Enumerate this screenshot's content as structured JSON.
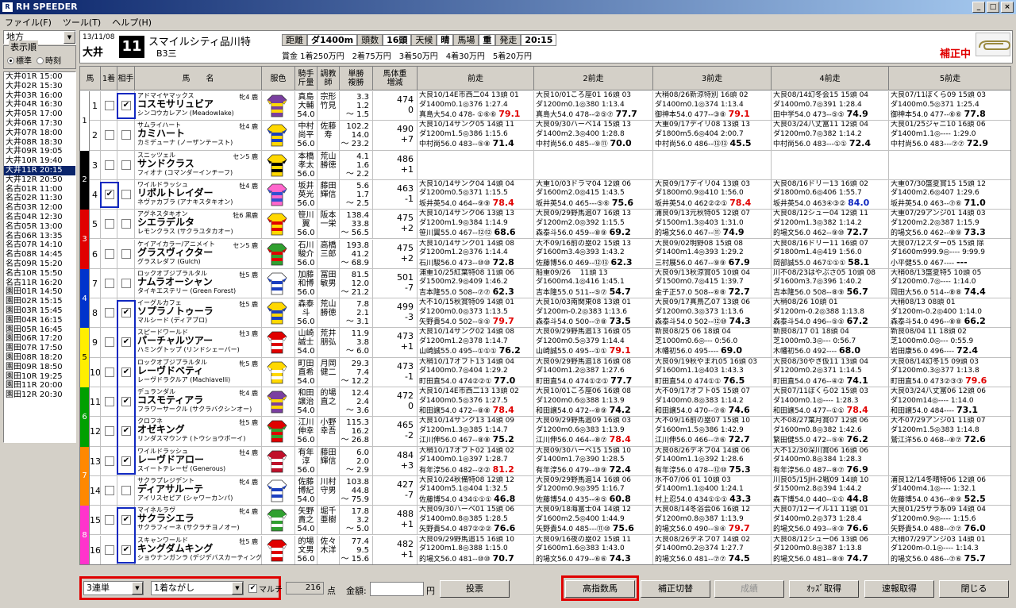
{
  "app": {
    "title": "RH SPEEDER",
    "icon": "rh-icon"
  },
  "window_buttons": [
    "_",
    "□",
    "×"
  ],
  "menu": [
    "ファイル(F)",
    "ツール(T)",
    "ヘルプ(H)"
  ],
  "left": {
    "region": "地方",
    "sort_legend": "表示順",
    "sort_options": [
      "標準",
      "時刻"
    ],
    "sort_selected": "標準",
    "races": [
      "大井01R 15:00",
      "大井02R 15:30",
      "大井03R 16:00",
      "大井04R 16:30",
      "大井05R 17:00",
      "大井06R 17:30",
      "大井07R 18:00",
      "大井08R 18:30",
      "大井09R 19:05",
      "大井10R 19:40",
      "大井11R 20:15",
      "大井12R 20:50",
      "名古01R 11:00",
      "名古02R 11:30",
      "名古03R 12:00",
      "名古04R 12:30",
      "名古05R 13:00",
      "名古06R 13:35",
      "名古07R 14:10",
      "名古08R 14:45",
      "名古09R 15:20",
      "名古10R 15:50",
      "名古11R 16:20",
      "園田01R 14:50",
      "園田02R 15:15",
      "園田03R 15:45",
      "園田04R 16:15",
      "園田05R 16:45",
      "園田06R 17:20",
      "園田07R 17:50",
      "園田08R 18:20",
      "園田09R 18:50",
      "園田10R 19:25",
      "園田11R 20:00",
      "園田12R 20:30"
    ],
    "selected_race": "大井11R 20:15"
  },
  "race": {
    "date": "13/11/08",
    "venue": "大井",
    "number": "11",
    "name": "スマイルシティ品川特",
    "class": "B3三",
    "conditions": [
      {
        "label": "距離",
        "value": "ダ1400m"
      },
      {
        "label": "頭数",
        "value": "16頭"
      },
      {
        "label": "天候",
        "value": "晴"
      },
      {
        "label": "馬場",
        "value": "重"
      },
      {
        "label": "発走",
        "value": "20:15"
      }
    ],
    "prize": "賞金 1着250万円　2着75万円　3着50万円　4着30万円　5着20万円",
    "hosei_label": "補正中"
  },
  "columns": [
    "馬",
    "1着",
    "相手",
    "馬　　名",
    "服色",
    "騎手\n斤量",
    "調教\n師",
    "単勝\n複勝",
    "馬体重\n増減",
    "前走",
    "2前走",
    "3前走",
    "4前走",
    "5前走"
  ],
  "waku_colors": [
    "#ffffff",
    "#000000",
    "#e00000",
    "#0033cc",
    "#ffee00",
    "#00a000",
    "#ff8800",
    "#ff33cc"
  ],
  "horses": [
    {
      "waku": 1,
      "num": "1",
      "first": false,
      "aite": true,
      "sire": "アドマイヤマックス",
      "sex": "牝4 鹿",
      "name": "コスモサリュビア",
      "dam": "シンコウカレアン (Meadowlake)",
      "jockey": "真島\n大輔\n54.0",
      "trainer": "宗形\n竹見",
      "odds": "3.3\n1.2\n～ 1.5",
      "weight": "474\n0",
      "silk": [
        "#7a3fa0",
        "#ffd800"
      ],
      "past": [
        [
          "大良10/14E市西二04 13頭 01",
          "ダ1400m0.1◎376 1:27.4",
          "真島大54.0 478- ①⑥⑥ ",
          "79.1"
        ],
        [
          "大良10/01ころ座01 16頭 03",
          "ダ1200m0.1◎380 1:13.4",
          "真島大54.0 478--②⑤⑦ ",
          "77.7"
        ],
        [
          "大稍08/26新涼特別 16頭 02",
          "ダ1400m0.1◎374 1:13.4",
          "御神本54.0 477--③⑧ ",
          "79.1"
        ],
        [
          "大良08/14幻冬会15 15頭 04",
          "ダ1400m0.7◎391 1:28.4",
          "田中学54.0 473--⑤⑤ ",
          "74.9"
        ],
        [
          "大良07/11ぼくら09 15頭 03",
          "ダ1400m0.5◎371 1:25.4",
          "御神本54.0 477--⑥⑥ ",
          "77.8"
        ]
      ]
    },
    {
      "waku": 1,
      "num": "2",
      "first": false,
      "aite": false,
      "sire": "サムライハート",
      "sex": "牡4 鹿",
      "name": "カミハート",
      "dam": "カミデューナ (ノーザンテースト)",
      "jockey": "中村\n尚平\n56.0",
      "trainer": "佐藤\n寿",
      "odds": "102.2\n14.0\n～ 23.2",
      "weight": "490\n+7",
      "silk": [
        "#ffd800",
        "#1a3fc0"
      ],
      "past": [
        [
          "大良10/14サンク05 14頭 11",
          "ダ1200m1.5◎386 1:15.6",
          "中村尚56.0 483--⑤⑧ ",
          "71.4"
        ],
        [
          "大良09/30ハーベ14 15頭 13",
          "ダ1400m2.3◎400 1:28.8",
          "中村尚56.0 485--⑨⑪ ",
          "70.0"
        ],
        [
          "大重09/17デイリ08 13頭 13",
          "ダ1800m5.6◎404 2:00.7",
          "中村尚56.0 486--⑬⑬ ",
          "45.5"
        ],
        [
          "大良03/24八丈富11 12頭 04",
          "ダ1200m0.7◎382 1:14.2",
          "中村尚56.0 483---①① ",
          "72.4"
        ],
        [
          "大良01/25ジャニ10 16頭 06",
          "ダ1400m1.1◎---- 1:29.0",
          "中村尚56.0 483---⑦⑦ ",
          "72.9"
        ]
      ]
    },
    {
      "waku": 2,
      "num": "3",
      "first": false,
      "aite": false,
      "sire": "スニッツェル",
      "sex": "セン5 鹿",
      "name": "サンドクラス",
      "dam": "フィオナ (コマンダーインチーフ)",
      "jockey": "本橋\n孝太\n56.0",
      "trainer": "荒山\n勝徳",
      "odds": "4.1\n1.6\n～ 2.2",
      "weight": "486\n+1",
      "silk": [
        "#ffd800",
        "#000000"
      ],
      "past": [
        [
          "",
          "",
          "",
          ""
        ],
        [
          "",
          "",
          "",
          ""
        ],
        [
          "",
          "",
          "",
          ""
        ],
        [
          "",
          "",
          "",
          ""
        ],
        [
          "",
          "",
          "",
          ""
        ]
      ]
    },
    {
      "waku": 2,
      "num": "4",
      "first": true,
      "aite": false,
      "sire": "ワイルドラッシュ",
      "sex": "牡4 鹿",
      "name": "リボルトレイダー",
      "dam": "ネヴァカブラ (アナキスタキオン)",
      "jockey": "坂井\n英光\n56.0",
      "trainer": "藤田\n輝信",
      "odds": "5.6\n1.7\n～ 2.5",
      "weight": "463\n-1",
      "silk": [
        "#ff66cc",
        "#3050d0"
      ],
      "past": [
        [
          "大良10/14サンク04 14頭 04",
          "ダ1200m0.5◎371 1:15.5",
          "坂井英54.0 464--⑨⑨ ",
          "78.4"
        ],
        [
          "大重10/03ドラマ04 12頭 06",
          "ダ1600m2.0◎415 1:43.5",
          "坂井英54.0 465---⑤⑥ ",
          "75.6"
        ],
        [
          "大良09/17デイリ04 13頭 03",
          "ダ1800m0.9◎410 1:56.0",
          "坂井英54.0 462②②① ",
          "78.4"
        ],
        [
          "大良08/16ドリー13 16頭 02",
          "ダ1800m0.6◎406 1:55.7",
          "坂井英54.0 463④③② ",
          "84.0"
        ],
        [
          "大重07/30盛夏賞15 15頭 12",
          "ダ1400m2.6◎407 1:29.6",
          "坂井英54.0 463--⑦⑥ ",
          "71.0"
        ]
      ]
    },
    {
      "waku": 3,
      "num": "5",
      "first": false,
      "aite": false,
      "sire": "アグネスタキオン",
      "sex": "牡6 黒鹿",
      "name": "シエラデルタ",
      "dam": "レモンクラス (サクラユタカオー)",
      "jockey": "笹川\n翼\n56.0",
      "trainer": "阪本\n一栄",
      "odds": "138.4\n33.8\n～ 56.5",
      "weight": "475\n+2",
      "silk": [
        "#ffd800",
        "#e00000"
      ],
      "past": [
        [
          "大良10/14サンク06 13頭 13",
          "ダ1200m1.9◎384 1:14.9",
          "笹川翼55.0 467--⑫⑫ ",
          "68.6"
        ],
        [
          "大良09/29野馬追07 16頭 13",
          "ダ1200m2.0◎392 1:15.5",
          "森泰斗56.0 459--⑧⑨ ",
          "69.2"
        ],
        [
          "浦良09/13元秋特05 12頭 07",
          "ダ1500m1.3◎403 1:31.0",
          "的場文56.0 467--⑪ ",
          "74.9"
        ],
        [
          "大良08/12シュー04 12頭 11",
          "ダ1200m1.3◎382 1:14.2",
          "的場文56.0 462--⑨⑩ ",
          "72.7"
        ],
        [
          "大重07/29アンジ01 14頭 03",
          "ダ1200m2.2◎387 1:15.9",
          "的場文56.0 462--⑧⑨ ",
          "73.3"
        ]
      ]
    },
    {
      "waku": 3,
      "num": "6",
      "first": false,
      "aite": false,
      "sire": "ケイアイカラー/アニメイト",
      "sex": "セン5 鹿",
      "name": "グラスヴィクター",
      "dam": "グラスレダフ (Gulch)",
      "jockey": "石川\n駿介\n56.0",
      "trainer": "高橋\n三郎",
      "odds": "193.8\n41.2\n～ 68.9",
      "weight": "475\n+2",
      "silk": [
        "#30a030",
        "#e00000"
      ],
      "past": [
        [
          "大良10/14サンク01 14頭 08",
          "ダ1200m1.2◎376 1:14.4",
          "石川駿56.0 473--⑩⑩ ",
          "72.8"
        ],
        [
          "大不09/16前の塁02 15頭 13",
          "ダ1600m3.4◎393 1:43.2",
          "佐藤博56.0 469--⑫⑬ ",
          "62.3"
        ],
        [
          "大良09/02明野08 15頭 08",
          "ダ1400m1.4◎393 1:29.2",
          "三村展56.0 467--⑨⑨ ",
          "67.9"
        ],
        [
          "大良08/16ドリー11 16頭 07",
          "ダ1800m1.4◎419 1:56.0",
          "岡部誠55.0 467①①① ",
          "58.1"
        ],
        [
          "大良07/12スター05 15頭 除",
          "ダ1600m999.9◎---- 9:99.9",
          "小平健55.0 467---- ",
          "---"
        ]
      ]
    },
    {
      "waku": 4,
      "num": "7",
      "first": false,
      "aite": false,
      "sire": "ロックオブジブラルタル",
      "sex": "牡5 鹿",
      "name": "ナムラオーシャン",
      "dam": "タイキエステリー (Green Forest)",
      "jockey": "加藤\n和博\n56.0",
      "trainer": "冨田\n敏男",
      "odds": "81.5\n12.0\n～ 21.2",
      "weight": "501\n-7",
      "silk": [
        "#ffffff",
        "#1a3fc0"
      ],
      "past": [
        [
          "浦重10/25紅葉特08 11頭 06",
          "ダ1500m2.9◎409 1:46.2",
          "吉本隆55.0 508--⑦⑦ ",
          "62.3"
        ],
        [
          "船重09/26　 11頭 13",
          "ダ1600m4.1◎416 1:45.1",
          "吉本隆55.0 511--⑤⑦ ",
          "54.7"
        ],
        [
          "大良09/13秋涼賞05 10頭 04",
          "ダ1500m0.7◎415 1:39.7",
          "金子正57.0 508--⑥⑧ ",
          "72.7"
        ],
        [
          "川不08/23はやぶさ05 10頭 08",
          "ダ1600m3.7◎396 1:40.2",
          "吉本隆56.0 508--⑧⑨ ",
          "56.7"
        ],
        [
          "大稍08/13盛夏特5 10頭 05",
          "ダ1200m0.7◎---- 1:14.0",
          "岡田大56.0 514--⑧⑧ ",
          "74.4"
        ]
      ]
    },
    {
      "waku": 4,
      "num": "8",
      "first": false,
      "aite": true,
      "sire": "イーグルカフェ",
      "sex": "牡5 鹿",
      "name": "ソプラノトゥーラ",
      "dam": "マルシード (ディアブロ)",
      "jockey": "森泰\n斗\n56.0",
      "trainer": "荒山\n勝徳",
      "odds": "7.8\n2.1\n～ 3.1",
      "weight": "499\n-3",
      "silk": [
        "#ffd800",
        "#1a3fc0"
      ],
      "past": [
        [
          "大不10/15秋賞特09 14頭 01",
          "ダ1200m0.0◎373 1:13.5",
          "矢野貴54.0 502--⑤⑤ ",
          "79.7"
        ],
        [
          "大良10/03南関東08 13頭 01",
          "ダ1200m-0.2◎383 1:13.6",
          "森泰斗54.0 500--⑦⑧ ",
          "73.5"
        ],
        [
          "大良09/17真鳥乙07 13頭 06",
          "ダ1200m0.3◎373 1:13.6",
          "森泰斗54.0 502--⑫⑩ ",
          "74.3"
        ],
        [
          "大稍08/26 10頭 01",
          "ダ1200m-0.2◎388 1:13.8",
          "森泰斗54.0 496--⑤⑤ ",
          "67.2"
        ],
        [
          "大稍08/13 08頭 01",
          "ダ1200m-0.2◎400 1:14.0",
          "森泰斗54.0 496--⑧⑧ ",
          "66.2"
        ]
      ]
    },
    {
      "waku": 5,
      "num": "9",
      "first": false,
      "aite": true,
      "sire": "スピードワールド",
      "sex": "牡3 鹿",
      "name": "パーチャルツアー",
      "dam": "ハミングトップ (リンドシェーバー)",
      "jockey": "山崎\n誠士\n54.0",
      "trainer": "荒井\n朋弘",
      "odds": "11.9\n3.8\n～ 6.0",
      "weight": "473\n+1",
      "silk": [
        "#e00000",
        "#ffffff"
      ],
      "past": [
        [
          "大良10/14サンク02 14頭 08",
          "ダ1200m1.2◎378 1:14.7",
          "山崎誠55.0 495--①①① ",
          "76.2"
        ],
        [
          "大良09/29野馬追13 16頭 05",
          "ダ1200m0.5◎379 1:14.4",
          "山崎誠55.0 495--①① ",
          "79.1"
        ],
        [
          "新良08/25 06 18頭 04",
          "芝1000m0.6◎--- 0:56.0",
          "木幡初56.0 495---- ",
          "69.0"
        ],
        [
          "新良08/17 01 18頭 04",
          "芝1000m0.3◎--- 0:56.7",
          "木幡初56.0 492---- ",
          "68.0"
        ],
        [
          "新良08/04 11 18頭 02",
          "芝1000m0.0◎--- 0:55.9",
          "岩田康56.0 496---- ",
          "72.4"
        ]
      ]
    },
    {
      "waku": 5,
      "num": "10",
      "first": false,
      "aite": true,
      "sire": "ロックオブジブラルタル",
      "sex": "牝5 鹿",
      "name": "レーヴドベティ",
      "dam": "レーヴドラクルア (Machiavelli)",
      "jockey": "町田\n直希\n54.0",
      "trainer": "月岡\n健二",
      "odds": "29.3\n7.4\n～ 12.2",
      "weight": "473\n-1",
      "silk": [
        "#ffd800",
        "#ffffff"
      ],
      "past": [
        [
          "大稍10/17オフト13 14頭 04",
          "ダ1400m0.7◎404 1:29.2",
          "町田直54.0 474②②① ",
          "77.0"
        ],
        [
          "大良09/29野馬追18 16頭 08",
          "ダ1400m1.2◎387 1:27.6",
          "町田直54.0 474①②① ",
          "77.7"
        ],
        [
          "大良09/19秋やまれ05 16頭 03",
          "ダ1600m1.1◎403 1:43.3",
          "町田直54.0 474①① ",
          "76.5"
        ],
        [
          "大良08/30やき仮11 13頭 04",
          "ダ1200m0.2◎371 1:14.5",
          "町田直54.0 476--④② ",
          "74.1"
        ],
        [
          "大良08/14幻冬15 09頭 03",
          "ダ1200m0.3◎377 1:13.8",
          "町田直54.0 473②③③ ",
          "79.6"
        ]
      ]
    },
    {
      "waku": 6,
      "num": "11",
      "first": false,
      "aite": true,
      "sire": "デュランダル",
      "sex": "牝4 鹿",
      "name": "コスモティアラ",
      "dam": "フラワーサークル (サクラバクシンオー)",
      "jockey": "和田\n譲治\n54.0",
      "trainer": "的場\n直之",
      "odds": "12.4\n2.4\n～ 3.6",
      "weight": "472\n0",
      "silk": [
        "#7a3fa0",
        "#ffd800"
      ],
      "past": [
        [
          "大良10/14E市西二13 13頭 02",
          "ダ1400m0.5◎376 1:27.5",
          "和田譲54.0 472--⑧⑧ ",
          "78.4"
        ],
        [
          "大良10/01ころ座06 16頭 08",
          "ダ1200m0.6◎388 1:13.9",
          "和田譲54.0 472--⑧⑨ ",
          "74.2"
        ],
        [
          "大不09/17オフト05 15頭 07",
          "ダ1400m0.8◎383 1:14.2",
          "和田譲54.0 470--⑦⑥ ",
          "74.6"
        ],
        [
          "大良07/11ぼくら02 15頭 03",
          "ダ1400m0.1◎---- 1:28.3",
          "和田譲54.0 477--①① ",
          "78.4"
        ],
        [
          "大良03/24八丈富06 12頭 06",
          "ダ1200m14◎---- 1:14.0",
          "和田譲54.0 484---- ",
          "73.1"
        ]
      ]
    },
    {
      "waku": 6,
      "num": "12",
      "first": false,
      "aite": true,
      "sire": "クロフネ",
      "sex": "牡5 鹿",
      "name": "オゼキング",
      "dam": "リンダスマウンテ (トウショウボーイ)",
      "jockey": "江川\n伸幸\n56.0",
      "trainer": "小野\n幸吾",
      "odds": "115.3\n16.2\n～ 26.8",
      "weight": "465\n-2",
      "silk": [
        "#e00000",
        "#30a030"
      ],
      "past": [
        [
          "大良10/14サンク13 14頭 09",
          "ダ1200m1.3◎385 1:14.7",
          "江川伸56.0 467--⑧⑧ ",
          "75.2"
        ],
        [
          "大良09/29野馬追09 16頭 03",
          "ダ1200m0.6◎383 1:13.9",
          "江川伸56.0 464--⑧⑦ ",
          "78.4"
        ],
        [
          "大不09/16前の塁07 15頭 10",
          "ダ1600m1.5◎386 1:42.9",
          "江川伸56.0 466--⑦⑥ ",
          "72.7"
        ],
        [
          "大不08/27葉月賞07 12頭 06",
          "ダ1600m0.8◎382 1:42.6",
          "繁田健55.0 472--⑤⑥ ",
          "76.2"
        ],
        [
          "大不07/29アンジ01 11頭 07",
          "ダ1200m1.5◎383 1:14.8",
          "鷲江洋56.0 468--⑧⑦ ",
          "72.6"
        ]
      ]
    },
    {
      "waku": 7,
      "num": "13",
      "first": false,
      "aite": true,
      "sire": "ワイルドラッシュ",
      "sex": "牡4 鹿",
      "name": "レーヴドアロー",
      "dam": "スイートテレーゼ (Generous)",
      "jockey": "有年\n淳\n56.0",
      "trainer": "藤田\n輝信",
      "odds": "6.0\n2.0\n～ 2.9",
      "weight": "484\n+3",
      "silk": [
        "#c0102a",
        "#ffffff"
      ],
      "past": [
        [
          "大稍10/17オフト02 14頭 02",
          "ダ1400m0.1◎397 1:28.7",
          "有年淳56.0 482--②② ",
          "81.2"
        ],
        [
          "大良09/30ハーベ15 15頭 10",
          "ダ1400m1.7◎390 1:28.5",
          "有年淳56.0 479--⑩⑨ ",
          "72.4"
        ],
        [
          "大良08/26デネブ04 14頭 06",
          "ダ1400m1.1◎392 1:28.6",
          "有年淳56.0 478--⑫⑩ ",
          "75.3"
        ],
        [
          "大不12/30深川賞06 16頭 06",
          "ダ1400m0.8◎384 1:28.3",
          "有年淳56.0 487--⑧⑦ ",
          "76.9"
        ],
        [
          "",
          "",
          "",
          ""
        ]
      ]
    },
    {
      "waku": 7,
      "num": "14",
      "first": false,
      "aite": false,
      "sire": "サクラプレジデント",
      "sex": "牝4 鹿",
      "name": "ディアサルーテ",
      "dam": "アイリスセピア (シャワーカンパ)",
      "jockey": "佐藤\n博紀\n54.0",
      "trainer": "川村\n守男",
      "odds": "103.8\n44.8\n～ 75.9",
      "weight": "427\n-7",
      "silk": [
        "#ffffff",
        "#1a3fc0"
      ],
      "past": [
        [
          "大良10/24秋備特08 12頭 12",
          "ダ1400m5.1◎404 1:32.5",
          "佐藤博54.0 434①①① ",
          "46.8"
        ],
        [
          "大良09/29野馬追14 16頭 06",
          "ダ1200m0.9◎395 1:16.7",
          "佐藤博54.0 435--④⑤ ",
          "60.8"
        ],
        [
          "水不07/06 01 10頭 03",
          "ダ1400m1.1◎400 1:24.1",
          "村上忍54.0 434①①① ",
          "43.3"
        ],
        [
          "川良05/15JH-2戦09 14頭 10",
          "ダ1500m2.8◎394 1:44.2",
          "森下博54.0 440--①① ",
          "44.8"
        ],
        [
          "浦良12/14冬晴特06 12頭 06",
          "ダ1400m4.1◎---- 1:32.1",
          "佐藤博54.0 436--⑧⑨ ",
          "52.5"
        ]
      ]
    },
    {
      "waku": 8,
      "num": "15",
      "first": false,
      "aite": true,
      "sire": "マイネルラヴ",
      "sex": "牝4 鹿",
      "name": "サクラシエラ",
      "dam": "サクラフィーネ (サクラチヨノオー)",
      "jockey": "矢野\n貴之\n54.0",
      "trainer": "堀千\n亜樹",
      "odds": "17.8\n3.2\n～ 5.0",
      "weight": "488\n+1",
      "silk": [
        "#30a030",
        "#ffffff"
      ],
      "past": [
        [
          "大良09/30ハーベ01 15頭 06",
          "ダ1400m0.8◎385 1:28.5",
          "矢野貴54.0 487②②② ",
          "76.6"
        ],
        [
          "大良09/18海富士04 14頭 12",
          "ダ1600m2.5◎400 1:44.9",
          "矢野貴54.0 485---⑪⑩ ",
          "75.6"
        ],
        [
          "大良08/14冬浴会06 16頭 12",
          "ダ1200m0.8◎387 1:13.9",
          "的場文56.0 490--⑤④ ",
          "79.7"
        ],
        [
          "大良07/12ーイル11 11頭 01",
          "ダ1400m0.2◎373 1:28.4",
          "的場文56.0 493--④③ ",
          "76.6"
        ],
        [
          "大良01/25サラ系09 14頭 04",
          "ダ1200m0.9◎---- 1:15.6",
          "矢野貴54.0 488--⑦⑦ ",
          "76.0"
        ]
      ]
    },
    {
      "waku": 8,
      "num": "16",
      "first": false,
      "aite": true,
      "sire": "スキャンワールド",
      "sex": "牡5 鹿",
      "name": "キングダムキング",
      "dam": "ショウナンガンラ (デジデバスカーティング)",
      "jockey": "的場\n文男\n56.0",
      "trainer": "佐々\n木洋",
      "odds": "77.4\n9.5\n～ 15.6",
      "weight": "482\n+1",
      "silk": [
        "#e00000",
        "#ffffff"
      ],
      "past": [
        [
          "大良09/29野馬追15 16頭 10",
          "ダ1200m1.8◎388 1:15.0",
          "的場文56.0 481--⑩⑩ ",
          "70.7"
        ],
        [
          "大良09/16夜の塁02 15頭 11",
          "ダ1600m1.6◎383 1:43.0",
          "的場文56.0 479--⑥⑥ ",
          "74.3"
        ],
        [
          "大良08/26デネブ07 14頭 02",
          "ダ1400m0.2◎374 1:27.7",
          "的場文56.0 481--⑦⑦ ",
          "74.5"
        ],
        [
          "大良08/12シュー06 13頭 06",
          "ダ1200m0.8◎387 1:13.8",
          "的場文56.0 481--⑧⑨ ",
          "74.7"
        ],
        [
          "大稍07/29アンジ03 14頭 01",
          "ダ1200m-0.1◎---- 1:14.3",
          "的場文56.0 486--⑦⑥ ",
          "75.7"
        ]
      ]
    }
  ],
  "bottom": {
    "bet_type": "3連単",
    "bet_method": "1着ながし",
    "multi_label": "マルチ",
    "multi_checked": true,
    "points": "216",
    "points_unit": "点",
    "amount_label": "金額:",
    "amount_value": "",
    "amount_unit": "円",
    "buttons": {
      "vote": "投票",
      "high_index": "高指数馬",
      "hosei_toggle": "補正切替",
      "result": "成績",
      "odds": "ｵｯｽﾞ取得",
      "flash": "速報取得",
      "close": "閉じる"
    }
  },
  "colors": {
    "title_start": "#0a246a",
    "title_end": "#a6caf0",
    "highlight_blue": "#1028c0",
    "highlight_red": "#e00000",
    "rating_red": "#e00000",
    "selected": "#0a246a"
  }
}
